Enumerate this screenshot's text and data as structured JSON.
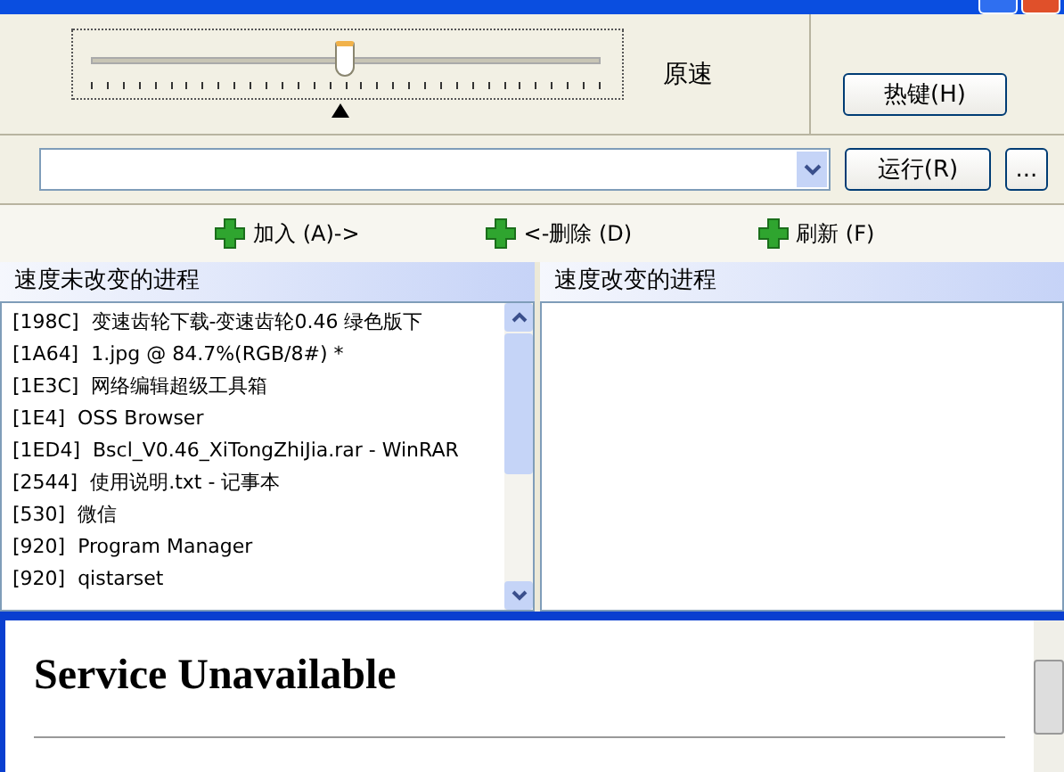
{
  "speed": {
    "level": 0.5,
    "label": "原速"
  },
  "hotkey_button": "热键(H)",
  "run_button": "运行(R)",
  "browse_button": "...",
  "actions": [
    {
      "label": "加入 (A)->"
    },
    {
      "label": "<-删除 (D)"
    },
    {
      "label": "刷新 (F)"
    }
  ],
  "unchanged_panel": {
    "title": "速度未改变的进程",
    "items": [
      {
        "pid": "[198C]",
        "name": "变速齿轮下载-变速齿轮0.46 绿色版下"
      },
      {
        "pid": "[1A64]",
        "name": "1.jpg @ 84.7%(RGB/8#) *"
      },
      {
        "pid": "[1E3C]",
        "name": "网络编辑超级工具箱"
      },
      {
        "pid": "[1E4]",
        "name": "OSS Browser"
      },
      {
        "pid": "[1ED4]",
        "name": "Bscl_V0.46_XiTongZhiJia.rar - WinRAR"
      },
      {
        "pid": "[2544]",
        "name": "使用说明.txt - 记事本"
      },
      {
        "pid": "[530]",
        "name": "微信"
      },
      {
        "pid": "[920]",
        "name": "Program Manager"
      },
      {
        "pid": "[920]",
        "name": "qistarset"
      }
    ]
  },
  "changed_panel": {
    "title": "速度改变的进程"
  },
  "browser": {
    "heading": "Service Unavailable"
  }
}
